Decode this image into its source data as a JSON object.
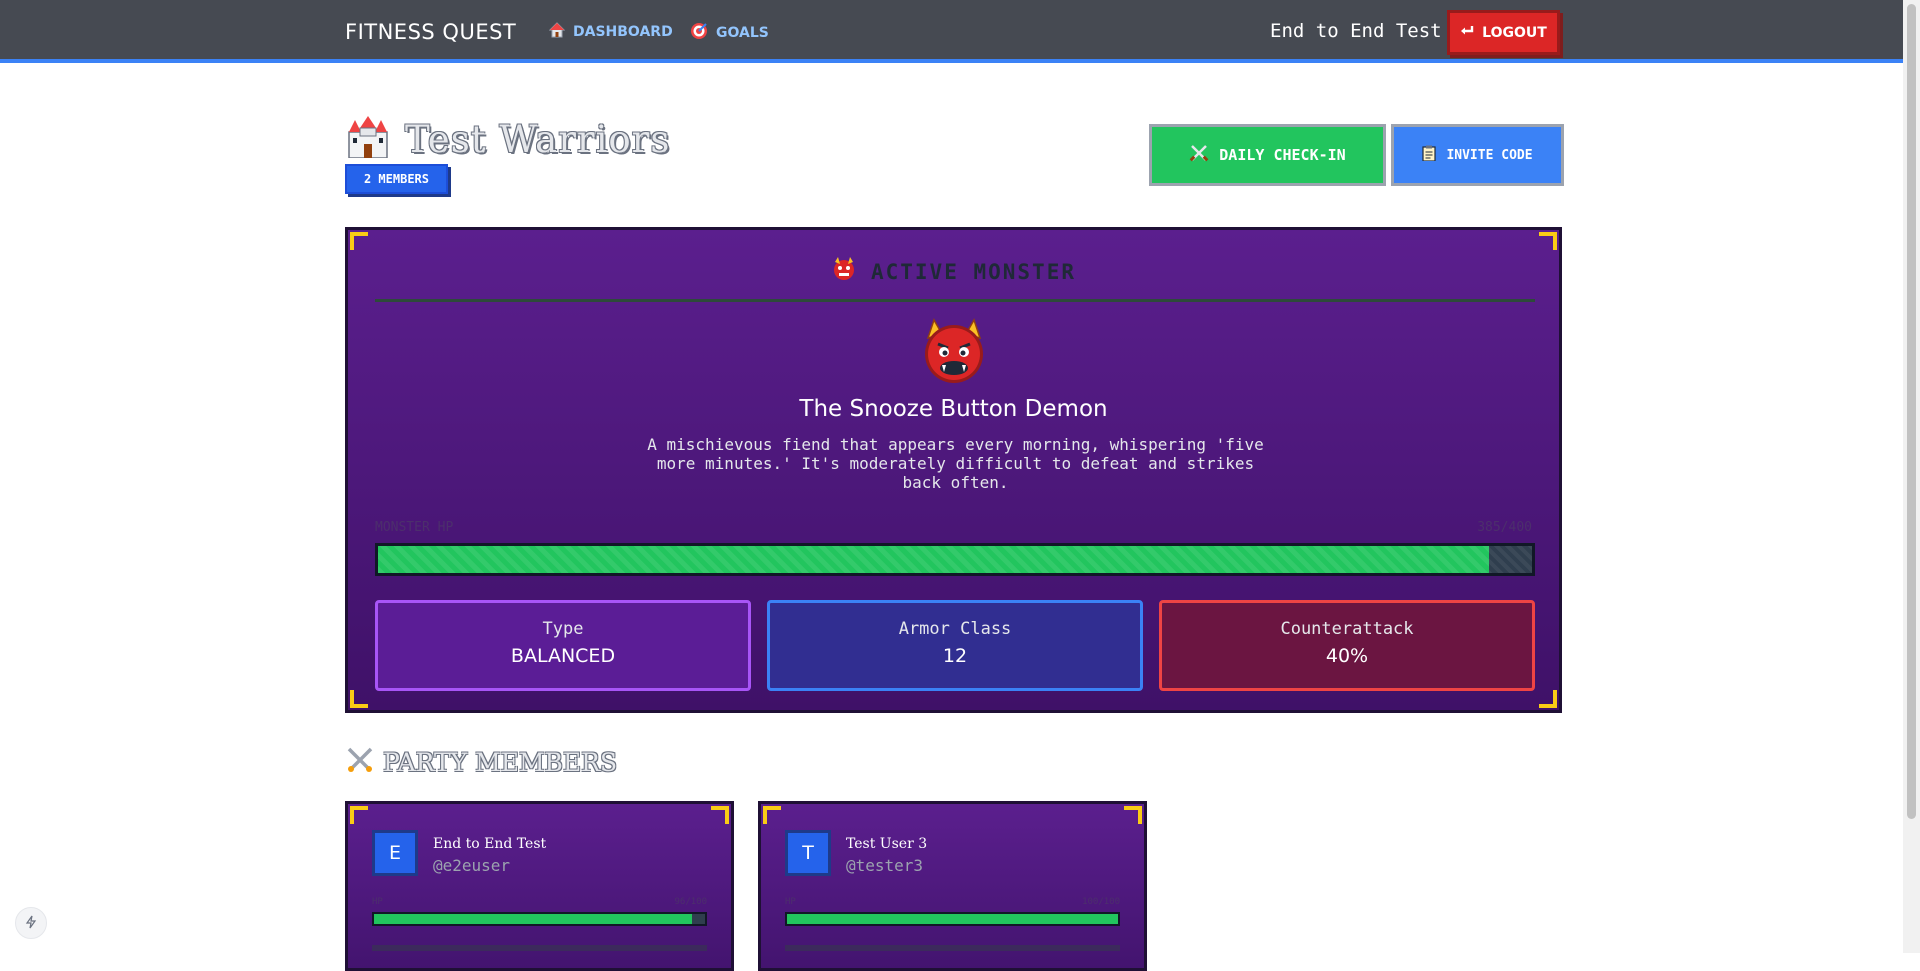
{
  "navbar": {
    "brand": "FITNESS QUEST",
    "links": [
      {
        "label": "DASHBOARD",
        "icon": "house-icon"
      },
      {
        "label": "GOALS",
        "icon": "target-icon"
      }
    ],
    "user_name": "End to End Test",
    "logout_label": "LOGOUT"
  },
  "party": {
    "name": "Test Warriors",
    "members_badge": "2 MEMBERS",
    "checkin_label": "DAILY CHECK-IN",
    "invite_label": "INVITE CODE"
  },
  "monster": {
    "section_title": "ACTIVE MONSTER",
    "name": "The Snooze Button Demon",
    "description": "A mischievous fiend that appears every morning, whispering 'five more minutes.' It's moderately difficult to defeat and strikes back often.",
    "hp_label": "MONSTER HP",
    "hp_text": "385/400",
    "hp_fraction": 0.9625,
    "stats": {
      "type_label": "Type",
      "type_value": "BALANCED",
      "armor_label": "Armor Class",
      "armor_value": "12",
      "counter_label": "Counterattack",
      "counter_value": "40%"
    }
  },
  "members_section": {
    "title": "PARTY MEMBERS",
    "members": [
      {
        "initial": "E",
        "name": "End to End Test",
        "handle": "@e2euser",
        "hp_label": "HP",
        "hp_text": "96/100",
        "hp_fraction": 0.96
      },
      {
        "initial": "T",
        "name": "Test User 3",
        "handle": "@tester3",
        "hp_label": "HP",
        "hp_text": "100/100",
        "hp_fraction": 1.0
      }
    ]
  },
  "colors": {
    "navbar": "#464a52",
    "accent_blue": "#3b82f6",
    "logout_red": "#dc2626",
    "checkin_green": "#22c55e",
    "panel_purple": "#5b1f8e",
    "corner_gold": "#facc15"
  }
}
